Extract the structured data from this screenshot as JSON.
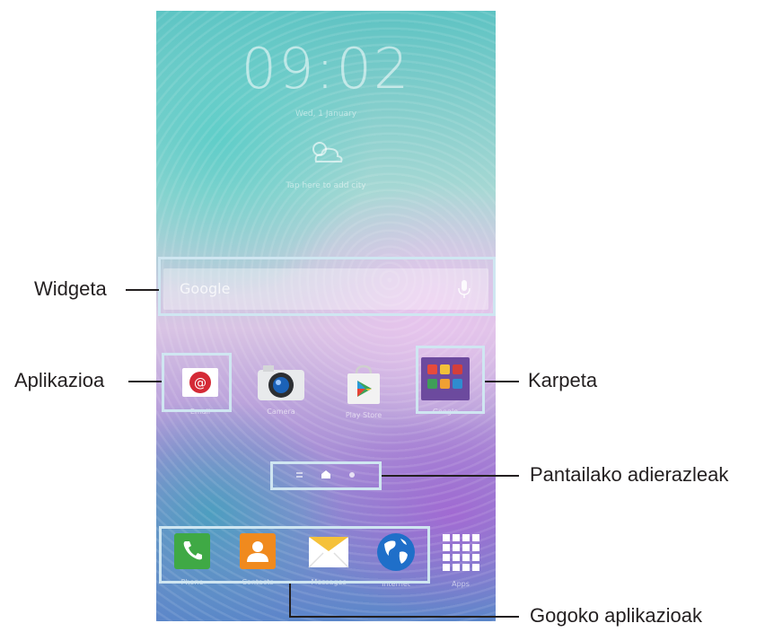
{
  "lock_clock": {
    "time": "09:02",
    "date": "Wed, 1 January",
    "weather": "Tap here to add city"
  },
  "widget": {
    "search_text": "Google"
  },
  "apps": [
    {
      "label": "Email",
      "icon": "email-icon"
    },
    {
      "label": "Camera",
      "icon": "camera-icon"
    },
    {
      "label": "Play Store",
      "icon": "play-store-icon"
    },
    {
      "label": "Google",
      "icon": "folder-icon"
    }
  ],
  "dock": [
    {
      "label": "Phone",
      "icon": "phone-icon"
    },
    {
      "label": "Contacts",
      "icon": "contacts-icon"
    },
    {
      "label": "Messages",
      "icon": "messages-icon"
    },
    {
      "label": "Internet",
      "icon": "globe-icon"
    },
    {
      "label": "Apps",
      "icon": "apps-grid-icon"
    }
  ],
  "callouts": {
    "widget": "Widgeta",
    "app": "Aplikazioa",
    "folder": "Karpeta",
    "indicators": "Pantailako adierazleak",
    "favorites": "Gogoko aplikazioak"
  },
  "colors": {
    "highlight": "#cfe6f1",
    "callout_line": "#231f20"
  }
}
